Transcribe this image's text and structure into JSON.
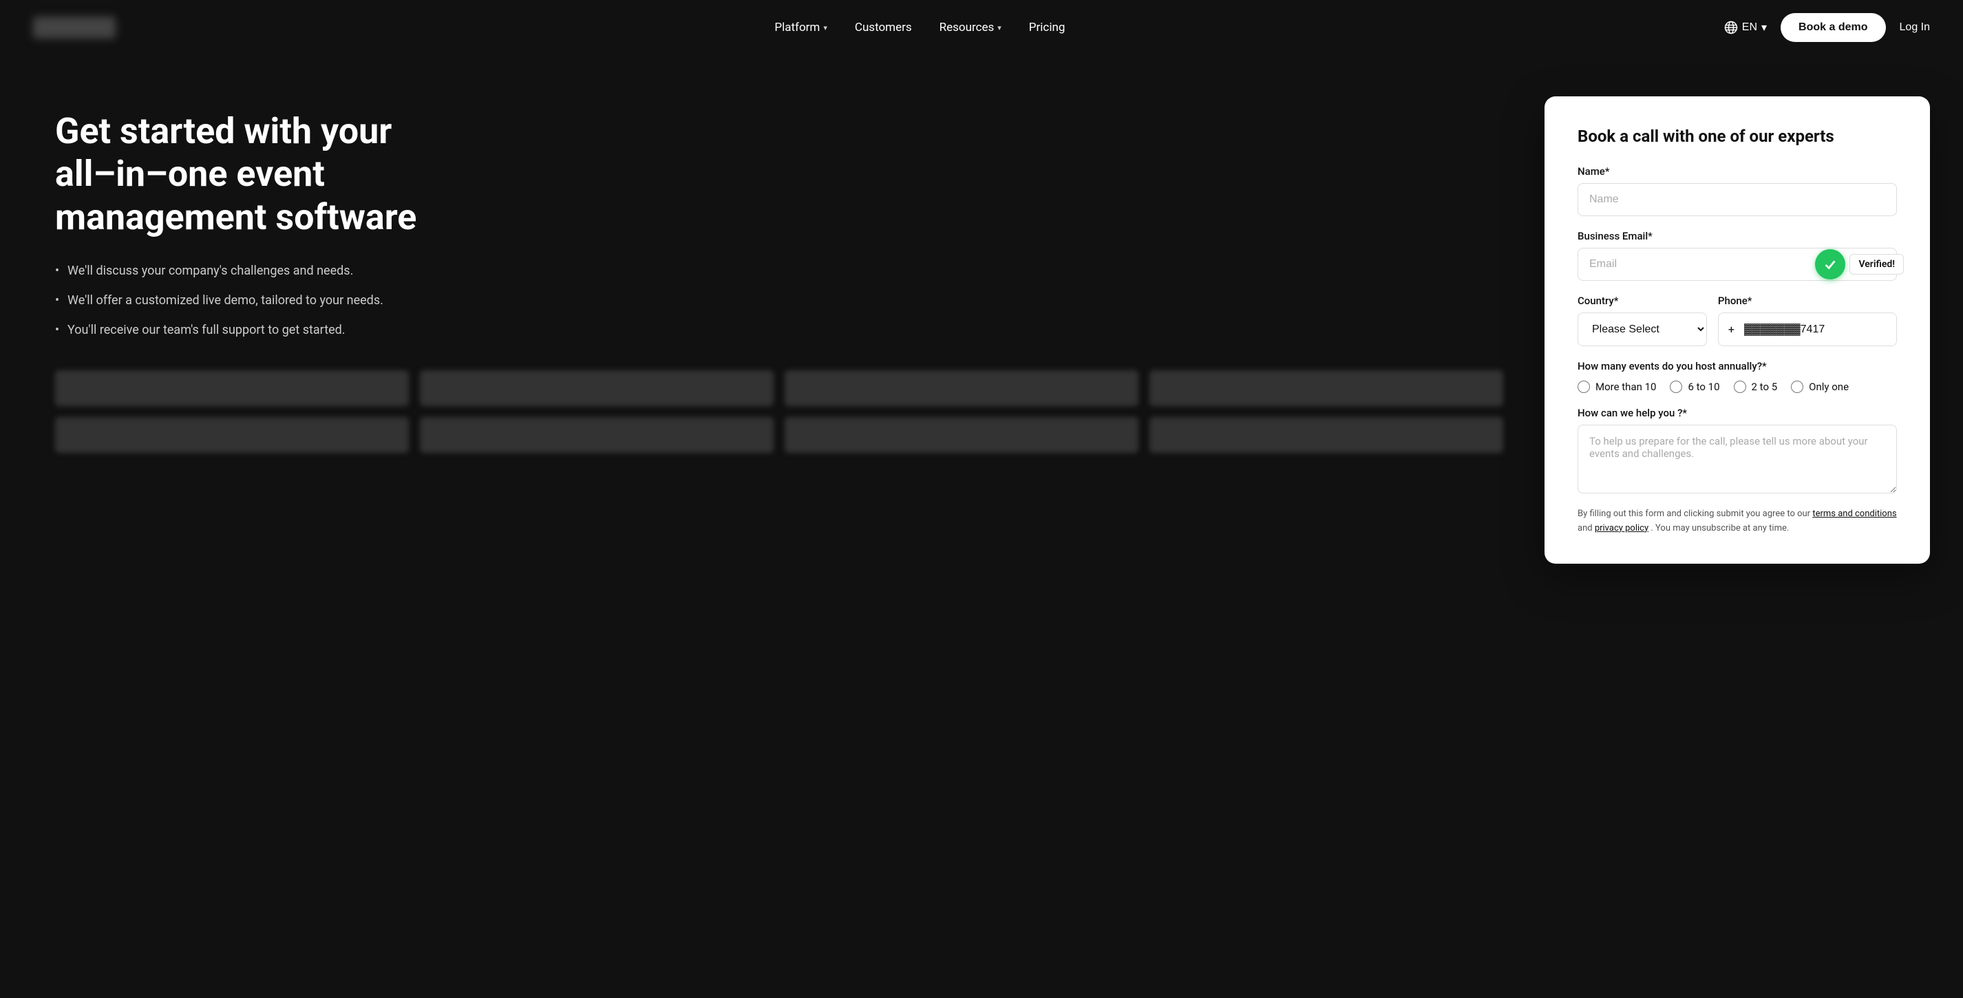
{
  "nav": {
    "logo_alt": "Company Logo",
    "links": [
      {
        "label": "Platform",
        "has_dropdown": true
      },
      {
        "label": "Customers",
        "has_dropdown": false
      },
      {
        "label": "Resources",
        "has_dropdown": true
      },
      {
        "label": "Pricing",
        "has_dropdown": false
      }
    ],
    "lang": "EN",
    "book_demo": "Book a demo",
    "login": "Log In"
  },
  "hero": {
    "title": "Get started with your all–in–one event management software",
    "bullets": [
      "We'll discuss your company's challenges and needs.",
      "We'll offer a customized live demo, tailored to your needs.",
      "You'll receive our team's full support to get started."
    ]
  },
  "form": {
    "title": "Book a call with one of our experts",
    "name_label": "Name*",
    "name_placeholder": "Name",
    "email_label": "Business Email*",
    "email_placeholder": "Email",
    "verified_text": "Verified!",
    "country_label": "Country*",
    "country_placeholder": "Please Select",
    "phone_label": "Phone*",
    "phone_prefix": "+",
    "phone_value": "7417",
    "events_label": "How many events do you host annually?*",
    "radio_options": [
      {
        "label": "More than 10",
        "value": "more_than_10"
      },
      {
        "label": "6 to 10",
        "value": "6_to_10"
      },
      {
        "label": "2 to 5",
        "value": "2_to_5"
      },
      {
        "label": "Only one",
        "value": "only_one"
      }
    ],
    "help_label": "How can we help you ?*",
    "help_placeholder": "To help us prepare for the call, please tell us more about your events and challenges.",
    "footer_text": "By filling out this form and clicking submit you agree to our ",
    "terms_link": "terms and conditions",
    "and_text": " and ",
    "privacy_link": "privacy policy",
    "footer_suffix": ". You may unsubscribe at any time."
  }
}
